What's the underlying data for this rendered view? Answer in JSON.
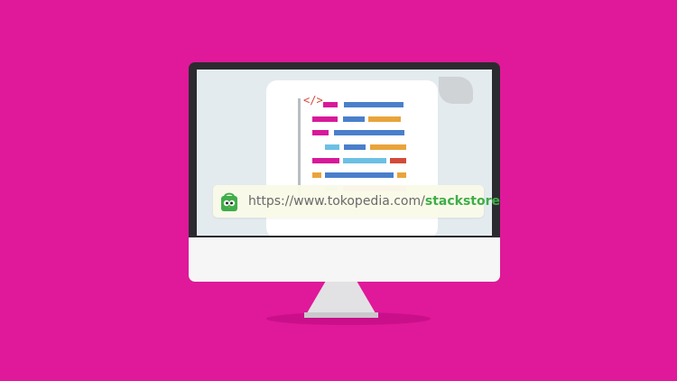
{
  "page": {
    "background_color": "#e0189a"
  },
  "screen": {
    "code_tag_symbol": "</>",
    "code_rows": [
      [
        {
          "color": "#d8199a"
        },
        {
          "color": "#4a7fcb"
        }
      ],
      [
        {
          "color": "#d8199a"
        },
        {
          "color": "#4a7fcb"
        },
        {
          "color": "#e9a43b"
        }
      ],
      [
        {
          "color": "#d8199a"
        },
        {
          "color": "#4a7fcb"
        }
      ],
      [
        {
          "color": "#6cc0e4"
        },
        {
          "color": "#4a7fcb"
        },
        {
          "color": "#e9a43b"
        }
      ],
      [
        {
          "color": "#d8199a"
        },
        {
          "color": "#6cc0e4"
        },
        {
          "color": "#d44a3a"
        }
      ],
      [
        {
          "color": "#e9a43b"
        },
        {
          "color": "#4a7fcb"
        },
        {
          "color": "#e9a43b"
        }
      ],
      [
        {
          "color": "#b7dfe9"
        },
        {
          "color": "#e79bcf"
        }
      ]
    ]
  },
  "address_bar": {
    "icon": "tokopedia-bag-icon",
    "url_base": "https://www.tokopedia.com/",
    "url_path": "stackstore",
    "url_path_color": "#3fae49"
  }
}
